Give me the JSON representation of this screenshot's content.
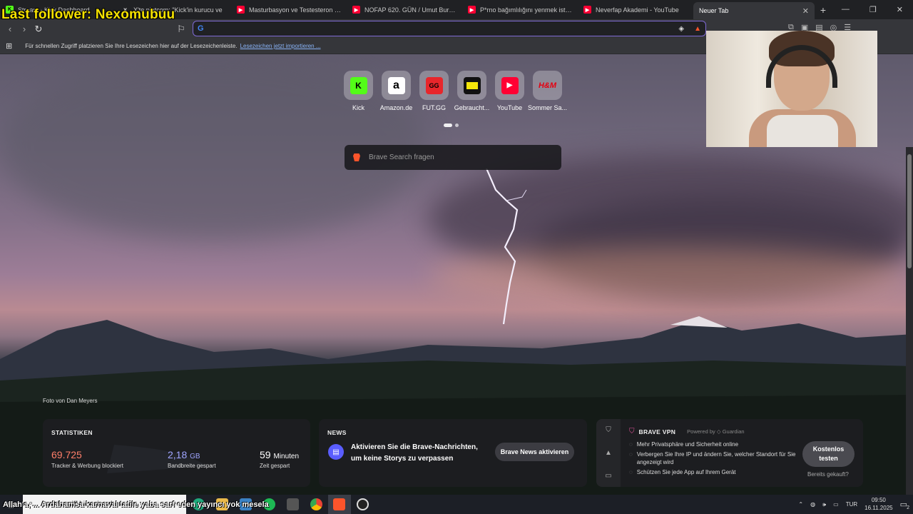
{
  "overlay": {
    "follower_text": "Last follower: Nexomubuu",
    "ticker_text": "Allah'a, ... Ardahamsa karnaval tatile yaba sarf eden yayıncı yok mesela"
  },
  "tabs": [
    {
      "label": "Stream - Kick Dashboard",
      "icon": "kick-icon",
      "color": "#53fc18"
    },
    {
      "label": "X'te platcom: \"Kick'in kurucu ve",
      "icon": "x-icon",
      "color": "#000000"
    },
    {
      "label": "Masturbasyon ve Testesteron İlişkisi",
      "icon": "youtube-icon",
      "color": "#ff0033"
    },
    {
      "label": "NOFAP 620. GÜN / Umut Bural - You",
      "icon": "youtube-icon",
      "color": "#ff0033"
    },
    {
      "label": "P*rno bağımlılığını yenmek ister mis",
      "icon": "youtube-icon",
      "color": "#ff0033"
    },
    {
      "label": "Neverfap Akademi - YouTube",
      "icon": "youtube-icon",
      "color": "#ff0033"
    },
    {
      "label": "Neuer Tab",
      "icon": "",
      "color": ""
    }
  ],
  "toolbar": {
    "omnibox_value": ""
  },
  "bookmarks": {
    "hint": "Für schnellen Zugriff platzieren Sie Ihre Lesezeichen hier auf der Lesezeichenleiste.",
    "import_link": "Lesezeichen jetzt importieren ..."
  },
  "topsites": [
    {
      "label": "Kick",
      "glyph": "K",
      "bg": "#53fc18",
      "fg": "#000000"
    },
    {
      "label": "Amazon.de",
      "glyph": "a",
      "bg": "#ffffff",
      "fg": "#000000"
    },
    {
      "label": "FUT.GG",
      "glyph": "GG",
      "bg": "#e8262b",
      "fg": "#000000"
    },
    {
      "label": "Gebraucht...",
      "glyph": "",
      "bg": "#f5e60a",
      "fg": "#000000"
    },
    {
      "label": "YouTube",
      "glyph": "▶",
      "bg": "#ff0033",
      "fg": "#ffffff"
    },
    {
      "label": "Sommer Sa...",
      "glyph": "H&M",
      "bg": "#e50010",
      "fg": "#ffffff"
    }
  ],
  "search": {
    "placeholder": "Brave Search fragen"
  },
  "photo_credit": "Foto von Dan Meyers",
  "stats": {
    "title": "STATISTIKEN",
    "trackers_value": "69.725",
    "trackers_label": "Tracker & Werbung blockiert",
    "bandwidth_value": "2,18",
    "bandwidth_unit": "GB",
    "bandwidth_label": "Bandbreite gespart",
    "time_value": "59",
    "time_unit": "Minuten",
    "time_label": "Zeit gespart"
  },
  "news": {
    "title": "NEWS",
    "text_line1": "Aktivieren Sie die Brave-Nachrichten,",
    "text_line2": "um keine Storys zu verpassen",
    "button": "Brave News aktivieren"
  },
  "vpn": {
    "title": "BRAVE VPN",
    "powered": "Powered by",
    "guardian": "Guardian",
    "features": [
      "Mehr Privatsphäre und Sicherheit online",
      "Verbergen Sie Ihre IP und ändern Sie, welcher Standort für Sie angezeigt wird",
      "Schützen Sie jede App auf Ihrem Gerät"
    ],
    "button": "Kostenlos testen",
    "already": "Bereits gekauft?"
  },
  "taskbar": {
    "search_placeholder": "Suchbegriff hier eingeben",
    "language": "TUR",
    "time": "09:50",
    "date": "16.11.2025",
    "notification_count": "2"
  }
}
